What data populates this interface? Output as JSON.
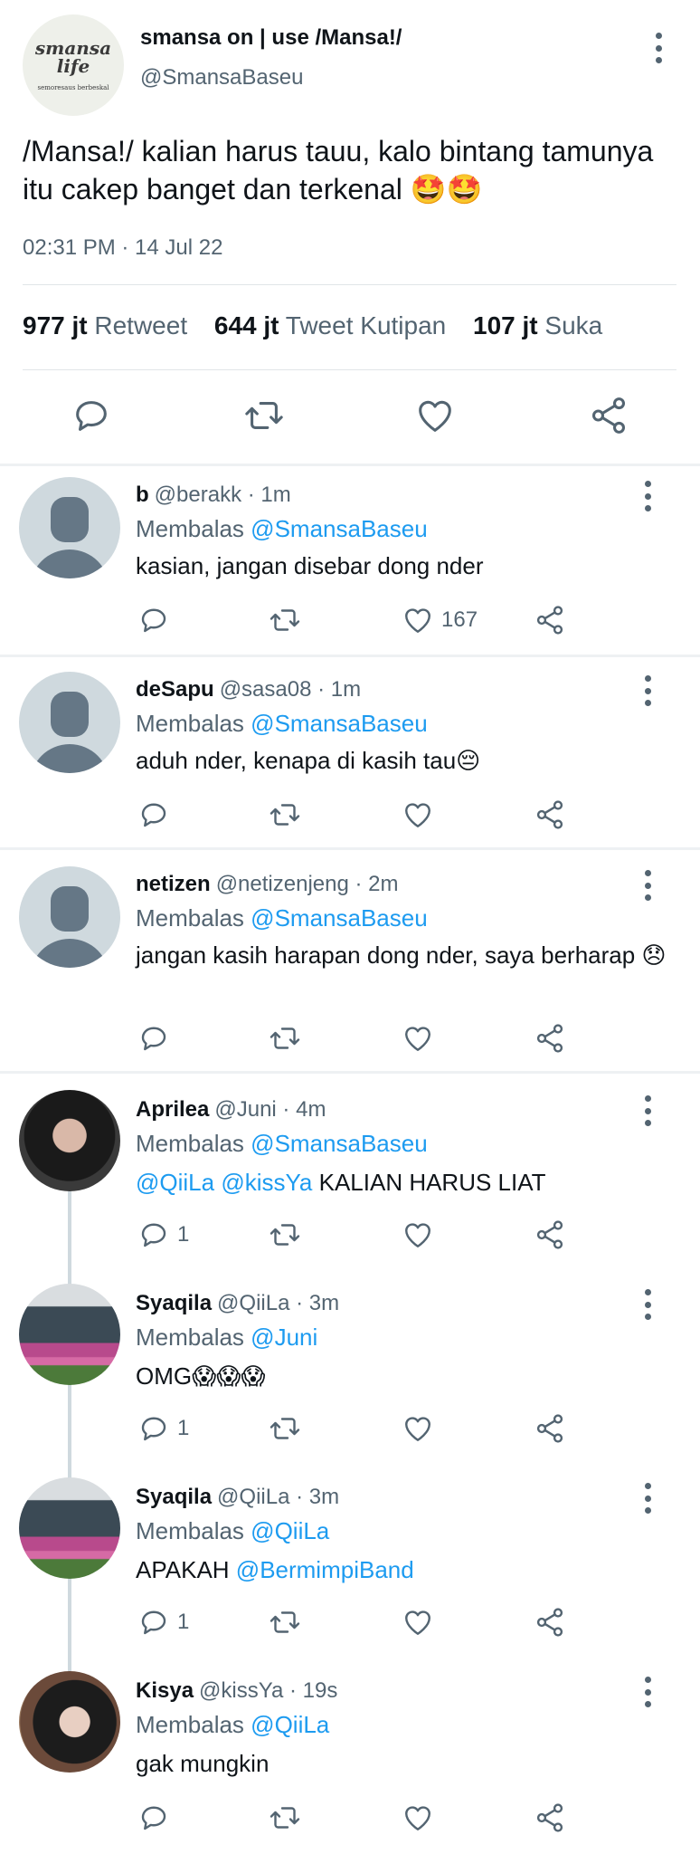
{
  "main_tweet": {
    "logo_text": "smansa\nlife",
    "logo_subtext": "semoresaus berbeskal",
    "name": "smansa on | use /Mansa!/",
    "handle": "@SmansaBaseu",
    "text": "/Mansa!/ kalian harus tauu, kalo bintang tamunya itu cakep banget dan terkenal 🤩🤩",
    "timestamp": "02:31 PM · 14 Jul 22",
    "stats": {
      "retweet_count": "977 jt",
      "retweet_label": "Retweet",
      "quote_count": "644 jt",
      "quote_label": "Tweet Kutipan",
      "like_count": "107 jt",
      "like_label": "Suka"
    }
  },
  "replies": [
    {
      "name": "b",
      "handle_time": "@berakk · 1m",
      "reply_prefix": "Membalas",
      "reply_to": "@SmansaBaseu",
      "text": "kasian, jangan disebar dong nder",
      "like_count": "167"
    },
    {
      "name": "deSapu",
      "handle_time": "@sasa08 · 1m",
      "reply_prefix": "Membalas",
      "reply_to": "@SmansaBaseu",
      "text": "aduh nder, kenapa di kasih tau😔"
    },
    {
      "name": "netizen",
      "handle_time": "@netizenjeng · 2m",
      "reply_prefix": "Membalas",
      "reply_to": "@SmansaBaseu",
      "text": "jangan kasih harapan dong nder, saya berharap 😞"
    },
    {
      "name": "Aprilea",
      "handle_time": "@Juni · 4m",
      "reply_prefix": "Membalas",
      "reply_to": "@SmansaBaseu",
      "mention1": "@QiiLa",
      "mention2": "@kissYa",
      "text_rest": "KALIAN HARUS LIAT",
      "reply_count": "1"
    },
    {
      "name": "Syaqila",
      "handle_time": "@QiiLa · 3m",
      "reply_prefix": "Membalas",
      "reply_to": "@Juni",
      "text": "OMG😱😱😱",
      "reply_count": "1"
    },
    {
      "name": "Syaqila",
      "handle_time": "@QiiLa · 3m",
      "reply_prefix": "Membalas",
      "reply_to": "@QiiLa",
      "text_prefix": "APAKAH",
      "mention": "@BermimpiBand",
      "reply_count": "1"
    },
    {
      "name": "Kisya",
      "handle_time": "@kissYa · 19s",
      "reply_prefix": "Membalas",
      "reply_to": "@QiiLa",
      "text": "gak mungkin"
    }
  ],
  "icons": {
    "reply": "reply-icon",
    "retweet": "retweet-icon",
    "like": "heart-icon",
    "share": "share-icon",
    "more": "more-icon"
  },
  "colors": {
    "link": "#1d9bf0",
    "secondary_text": "#536471",
    "primary_text": "#0f1419"
  }
}
